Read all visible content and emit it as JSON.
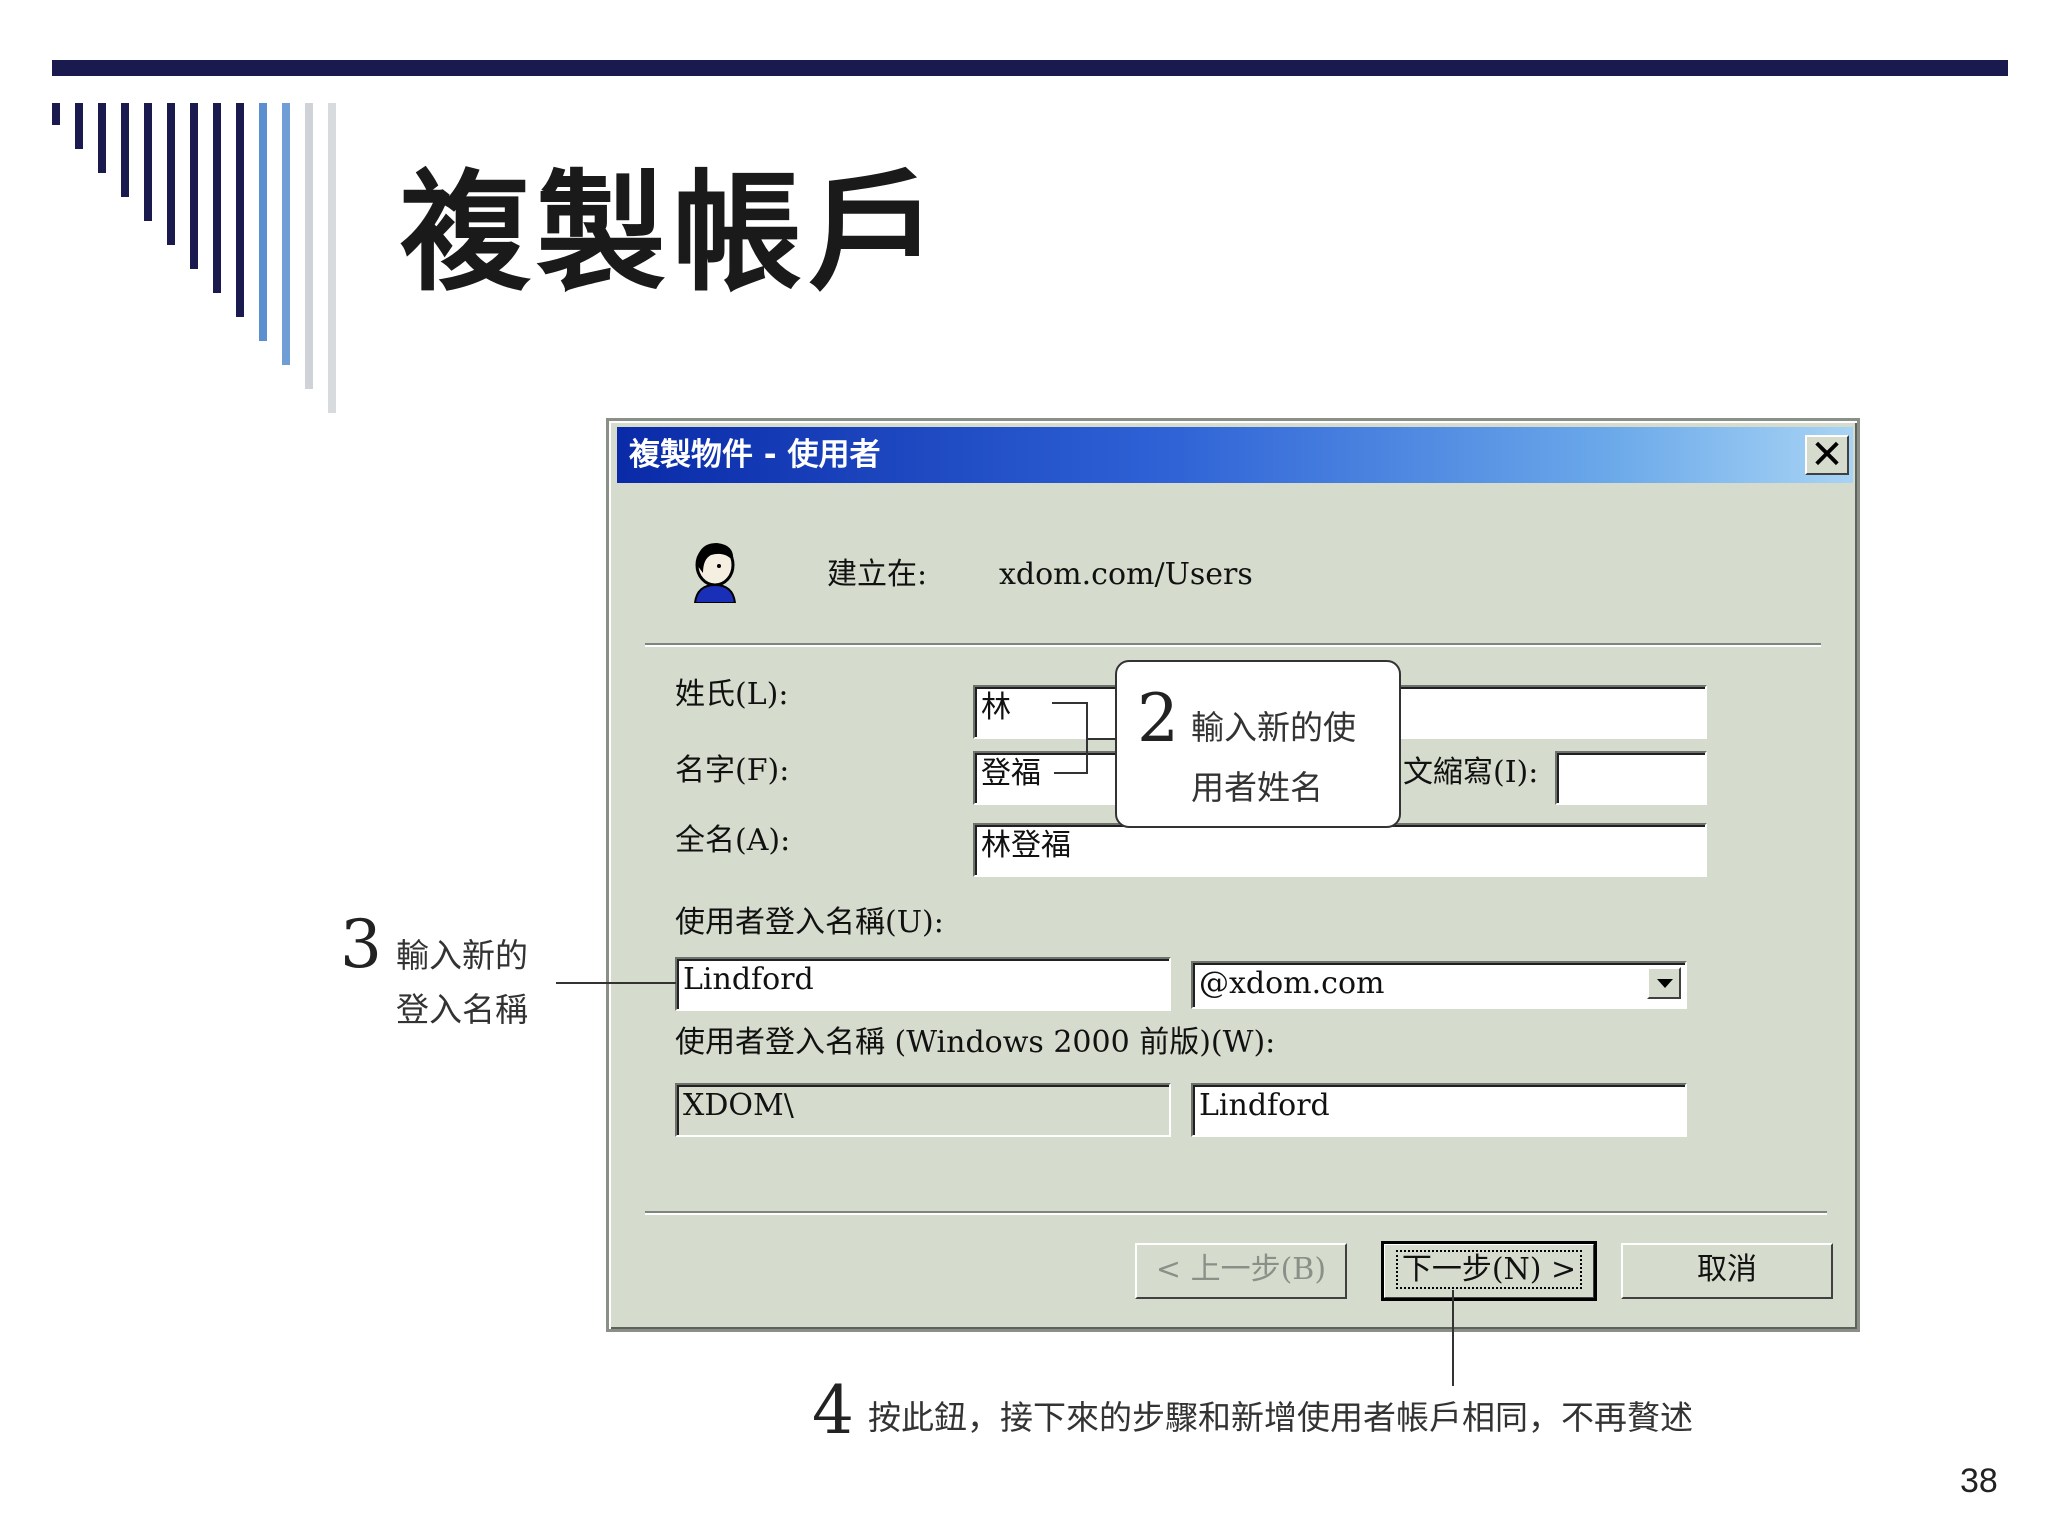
{
  "slide": {
    "title": "複製帳戶",
    "page_number": "38"
  },
  "dialog": {
    "title": "複製物件 - 使用者",
    "close_label": "✕",
    "created_in_label": "建立在:",
    "created_in_value": "xdom.com/Users",
    "last_name_label": "姓氏(L):",
    "last_name_value": "林",
    "first_name_label": "名字(F):",
    "first_name_value": "登福",
    "initials_label": "文縮寫(I):",
    "initials_value": "",
    "full_name_label": "全名(A):",
    "full_name_value": "林登福",
    "logon_name_label": "使用者登入名稱(U):",
    "logon_name_value": "Lindford",
    "domain_suffix_value": "@xdom.com",
    "pre2000_label": "使用者登入名稱 (Windows 2000 前版)(W):",
    "pre2000_domain_value": "XDOM\\",
    "pre2000_name_value": "Lindford",
    "back_button": "< 上一步(B)",
    "next_button": "下一步(N) >",
    "cancel_button": "取消"
  },
  "callouts": {
    "c2_number": "2",
    "c2_line1": "輸入新的使",
    "c2_line2": "用者姓名",
    "c3_number": "3",
    "c3_line1": "輸入新的",
    "c3_line2": "登入名稱",
    "c4_number": "4",
    "c4_text": "按此鈕，接下來的步驟和新增使用者帳戶相同，不再贅述"
  },
  "colors": {
    "title_bar_start": "#0a2aa8",
    "title_bar_end": "#a8d4f4",
    "dialog_bg": "#d5dccd",
    "rule": "#1a1a4e"
  },
  "icons": {
    "user": "user-icon",
    "close": "close-icon",
    "dropdown": "chevron-down-icon"
  }
}
